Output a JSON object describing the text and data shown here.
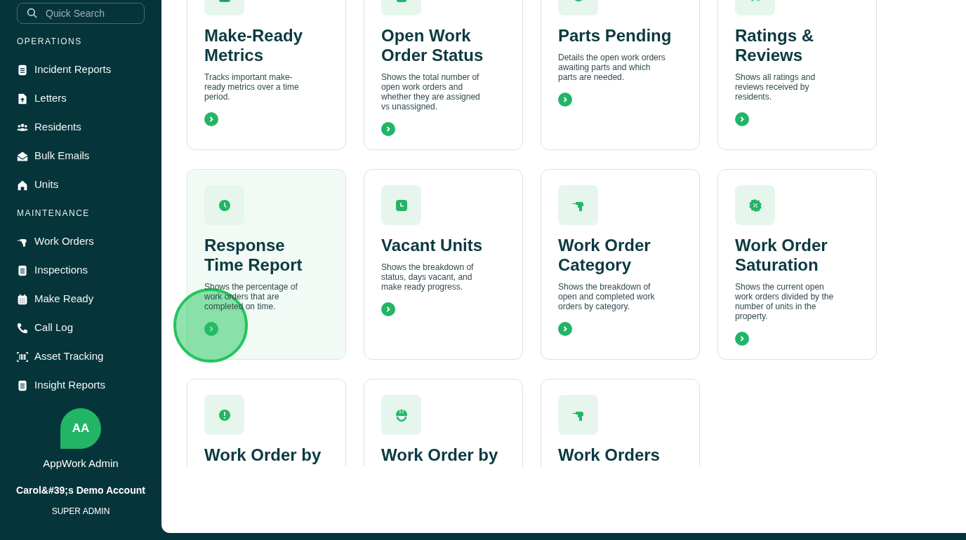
{
  "sidebar": {
    "search": {
      "placeholder": "Quick Search"
    },
    "sections": [
      {
        "heading": "OPERATIONS",
        "items": [
          {
            "label": "Incident Reports",
            "kind": "document"
          },
          {
            "label": "Letters",
            "kind": "upload"
          },
          {
            "label": "Residents",
            "kind": "people"
          },
          {
            "label": "Bulk Emails",
            "kind": "envelope"
          },
          {
            "label": "Units",
            "kind": "house"
          }
        ]
      },
      {
        "heading": "MAINTENANCE",
        "items": [
          {
            "label": "Work Orders",
            "kind": "drill"
          },
          {
            "label": "Inspections",
            "kind": "document"
          },
          {
            "label": "Make Ready",
            "kind": "calendar"
          },
          {
            "label": "Call Log",
            "kind": "phone"
          },
          {
            "label": "Asset Tracking",
            "kind": "barcode"
          },
          {
            "label": "Insight Reports",
            "kind": "document"
          }
        ]
      }
    ],
    "user": {
      "initials": "AA",
      "name": "AppWork Admin",
      "account": "Carol&#39;s Demo Account",
      "role": "SUPER ADMIN"
    }
  },
  "reports": [
    {
      "title": "Make-Ready Metrics",
      "description": "Tracks important make-ready metrics over a time period.",
      "kind": "calendar",
      "highlighted": false
    },
    {
      "title": "Open Work Order Status",
      "description": "Shows the total number of open work orders and whether they are assigned vs unassigned.",
      "kind": "document",
      "highlighted": false
    },
    {
      "title": "Parts Pending",
      "description": "Details the open work orders awaiting parts and which parts are needed.",
      "kind": "clock",
      "highlighted": false
    },
    {
      "title": "Ratings & Reviews",
      "description": "Shows all ratings and reviews received by residents.",
      "kind": "star",
      "highlighted": false
    },
    {
      "title": "Response Time Report",
      "description": "Shows the percentage of work orders that are completed on time.",
      "kind": "clock",
      "highlighted": true
    },
    {
      "title": "Vacant Units",
      "description": "Shows the breakdown of status, days vacant, and make ready progress.",
      "kind": "square-clock",
      "highlighted": false
    },
    {
      "title": "Work Order Category",
      "description": "Shows the breakdown of open and completed work orders by category.",
      "kind": "drill",
      "highlighted": false
    },
    {
      "title": "Work Order Saturation",
      "description": "Shows the current open work orders divided by the number of units in the property.",
      "kind": "badge",
      "highlighted": false
    },
    {
      "title": "Work Order by",
      "kind": "alert",
      "highlighted": false
    },
    {
      "title": "Work Order by",
      "kind": "helmet",
      "highlighted": false
    },
    {
      "title": "Work Orders",
      "kind": "drill",
      "highlighted": false
    }
  ]
}
